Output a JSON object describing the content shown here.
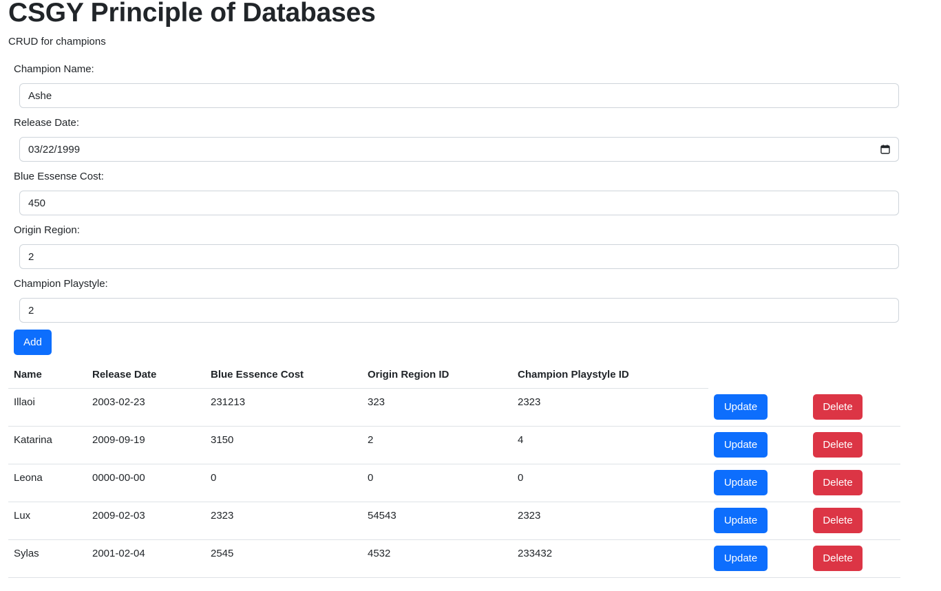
{
  "page": {
    "title": "CSGY Principle of Databases",
    "subtitle": "CRUD for champions"
  },
  "form": {
    "fields": [
      {
        "label": "Champion Name:",
        "value": "Ashe"
      },
      {
        "label": "Release Date:",
        "value": "03/22/1999",
        "icon": "calendar-icon"
      },
      {
        "label": "Blue Essense Cost:",
        "value": "450"
      },
      {
        "label": "Origin Region:",
        "value": "2"
      },
      {
        "label": "Champion Playstyle:",
        "value": "2"
      }
    ],
    "add_label": "Add"
  },
  "colors": {
    "primary": "#0d6efd",
    "danger": "#dc3545",
    "text": "#212529",
    "border": "#ced4da"
  },
  "table": {
    "headers": [
      "Name",
      "Release Date",
      "Blue Essence Cost",
      "Origin Region ID",
      "Champion Playstyle ID"
    ],
    "update_label": "Update",
    "delete_label": "Delete",
    "rows": [
      [
        "Illaoi",
        "2003-02-23",
        "231213",
        "323",
        "2323"
      ],
      [
        "Katarina",
        "2009-09-19",
        "3150",
        "2",
        "4"
      ],
      [
        "Leona",
        "0000-00-00",
        "0",
        "0",
        "0"
      ],
      [
        "Lux",
        "2009-02-03",
        "2323",
        "54543",
        "2323"
      ],
      [
        "Sylas",
        "2001-02-04",
        "2545",
        "4532",
        "233432"
      ]
    ]
  }
}
